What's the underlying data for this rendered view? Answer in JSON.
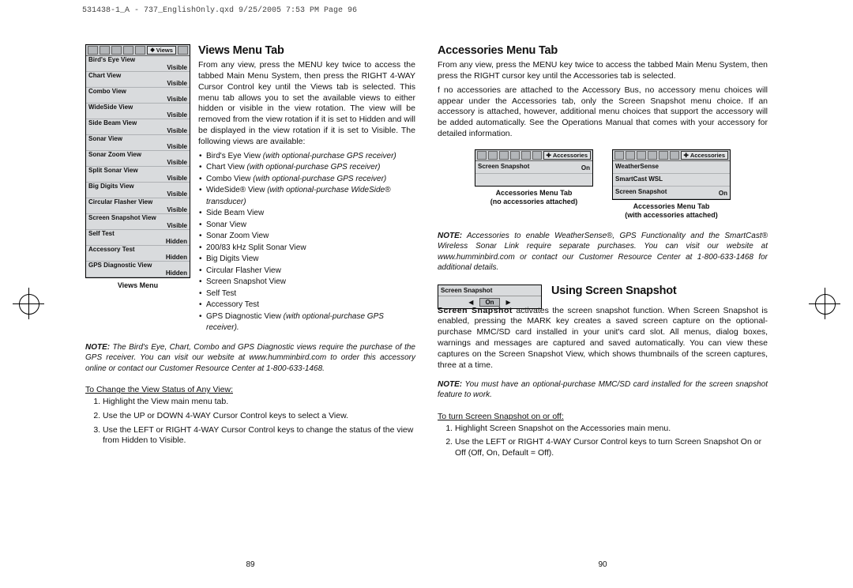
{
  "header_line": "531438-1_A - 737_EnglishOnly.qxd  9/25/2005  7:53 PM  Page 96",
  "left": {
    "title": "Views Menu Tab",
    "intro": "From any view, press the MENU key twice to access the tabbed Main Menu System, then press the RIGHT 4-WAY Cursor Control key until the Views tab is selected. This menu tab allows you to set the available views to either hidden or visible in the view rotation.  The view will be removed from the view rotation if it is set to Hidden and will be displayed in the view rotation if it is set to Visible. The following views are available:",
    "views_menu_tab_label": "Views",
    "views_menu_caption": "Views Menu",
    "views_rows": [
      {
        "name": "Bird's Eye View",
        "state": "Visible"
      },
      {
        "name": "Chart View",
        "state": "Visible"
      },
      {
        "name": "Combo View",
        "state": "Visible"
      },
      {
        "name": "WideSide View",
        "state": "Visible"
      },
      {
        "name": "Side Beam View",
        "state": "Visible"
      },
      {
        "name": "Sonar View",
        "state": "Visible"
      },
      {
        "name": "Sonar Zoom View",
        "state": "Visible"
      },
      {
        "name": "Split Sonar View",
        "state": "Visible"
      },
      {
        "name": "Big Digits View",
        "state": "Visible"
      },
      {
        "name": "Circular Flasher View",
        "state": "Visible"
      },
      {
        "name": "Screen Snapshot View",
        "state": "Visible"
      },
      {
        "name": "Self Test",
        "state": "Hidden"
      },
      {
        "name": "Accessory Test",
        "state": "Hidden"
      },
      {
        "name": "GPS Diagnostic View",
        "state": "Hidden"
      }
    ],
    "bullets": [
      {
        "t": "Bird's Eye View",
        "i": "(with optional-purchase GPS receiver)"
      },
      {
        "t": "Chart View",
        "i": "(with optional-purchase GPS receiver)"
      },
      {
        "t": "Combo View",
        "i": "(with optional-purchase GPS receiver)"
      },
      {
        "t": "WideSide® View",
        "i": "(with optional-purchase WideSide® transducer)"
      },
      {
        "t": "Side Beam View",
        "i": ""
      },
      {
        "t": "Sonar View",
        "i": ""
      },
      {
        "t": "Sonar Zoom View",
        "i": ""
      },
      {
        "t": "200/83 kHz Split Sonar View",
        "i": ""
      },
      {
        "t": "Big Digits View",
        "i": ""
      },
      {
        "t": "Circular Flasher View",
        "i": ""
      },
      {
        "t": "Screen Snapshot View",
        "i": ""
      },
      {
        "t": "Self Test",
        "i": ""
      },
      {
        "t": "Accessory Test",
        "i": ""
      },
      {
        "t": "GPS Diagnostic View",
        "i": "(with optional-purchase GPS receiver)."
      }
    ],
    "note": "The Bird's Eye, Chart, Combo and GPS Diagnostic views require the purchase of the GPS receiver. You can visit our website at www.humminbird.com to order this accessory online or contact our Customer Resource Center at 1-800-633-1468.",
    "sub_head": "To Change the View Status of Any View:",
    "steps": [
      "Highlight the View main menu tab.",
      "Use the UP or DOWN 4-WAY Cursor Control keys to select a View.",
      "Use the LEFT or RIGHT 4-WAY Cursor Control keys to change the status of the view from Hidden to Visible."
    ],
    "pagenum": "89"
  },
  "right": {
    "title": "Accessories Menu Tab",
    "intro": "From any view, press the MENU key twice to access the tabbed Main Menu System, then press the RIGHT cursor key until the Accessories tab is selected.",
    "para2": "f no accessories are attached to the Accessory Bus, no accessory menu choices will appear under the Accessories tab, only the Screen Snapshot menu choice. If an accessory is attached, however, additional menu choices that support the accessory will be added automatically.  See the Operations Manual that comes with your accessory for detailed information.",
    "fig_a": {
      "tab_label": "Accessories",
      "rows": [
        {
          "name": "Screen Snapshot",
          "state": "On"
        }
      ],
      "cap1": "Accessories Menu Tab",
      "cap2": "(no accessories attached)"
    },
    "fig_b": {
      "tab_label": "Accessories",
      "rows": [
        {
          "name": "WeatherSense",
          "state": ""
        },
        {
          "name": "SmartCast WSL",
          "state": ""
        },
        {
          "name": "Screen Snapshot",
          "state": "On"
        }
      ],
      "cap1": "Accessories Menu Tab",
      "cap2": "(with accessories attached)"
    },
    "note1": "Accessories to enable WeatherSense®, GPS Functionality and the SmartCast® Wireless Sonar Link require separate purchases.  You can visit our website at www.humminbird.com or contact our Customer Resource Center at 1-800-633-1468 for additional details.",
    "sec2_title": "Using Screen Snapshot",
    "snap_name": "Screen Snapshot",
    "snap_value": "On",
    "sec2_p": "Screen Snapshot activates the screen snapshot function. When Screen Snapshot is enabled, pressing the MARK key creates a saved screen capture on the optional-purchase MMC/SD card installed in your unit's card slot. All menus, dialog boxes, warnings and messages are captured and saved automatically. You can view these captures on the Screen Snapshot View, which shows thumbnails of the screen captures, three at a time.",
    "note2": "You must have an optional-purchase MMC/SD card installed for the screen snapshot feature to work.",
    "sub_head": "To turn Screen Snapshot on or off:",
    "steps": [
      "Highlight Screen Snapshot on the Accessories main menu.",
      "Use the LEFT or RIGHT 4-WAY Cursor Control keys to turn Screen Snapshot On or Off (Off, On, Default = Off)."
    ],
    "pagenum": "90"
  },
  "note_label": "NOTE:"
}
